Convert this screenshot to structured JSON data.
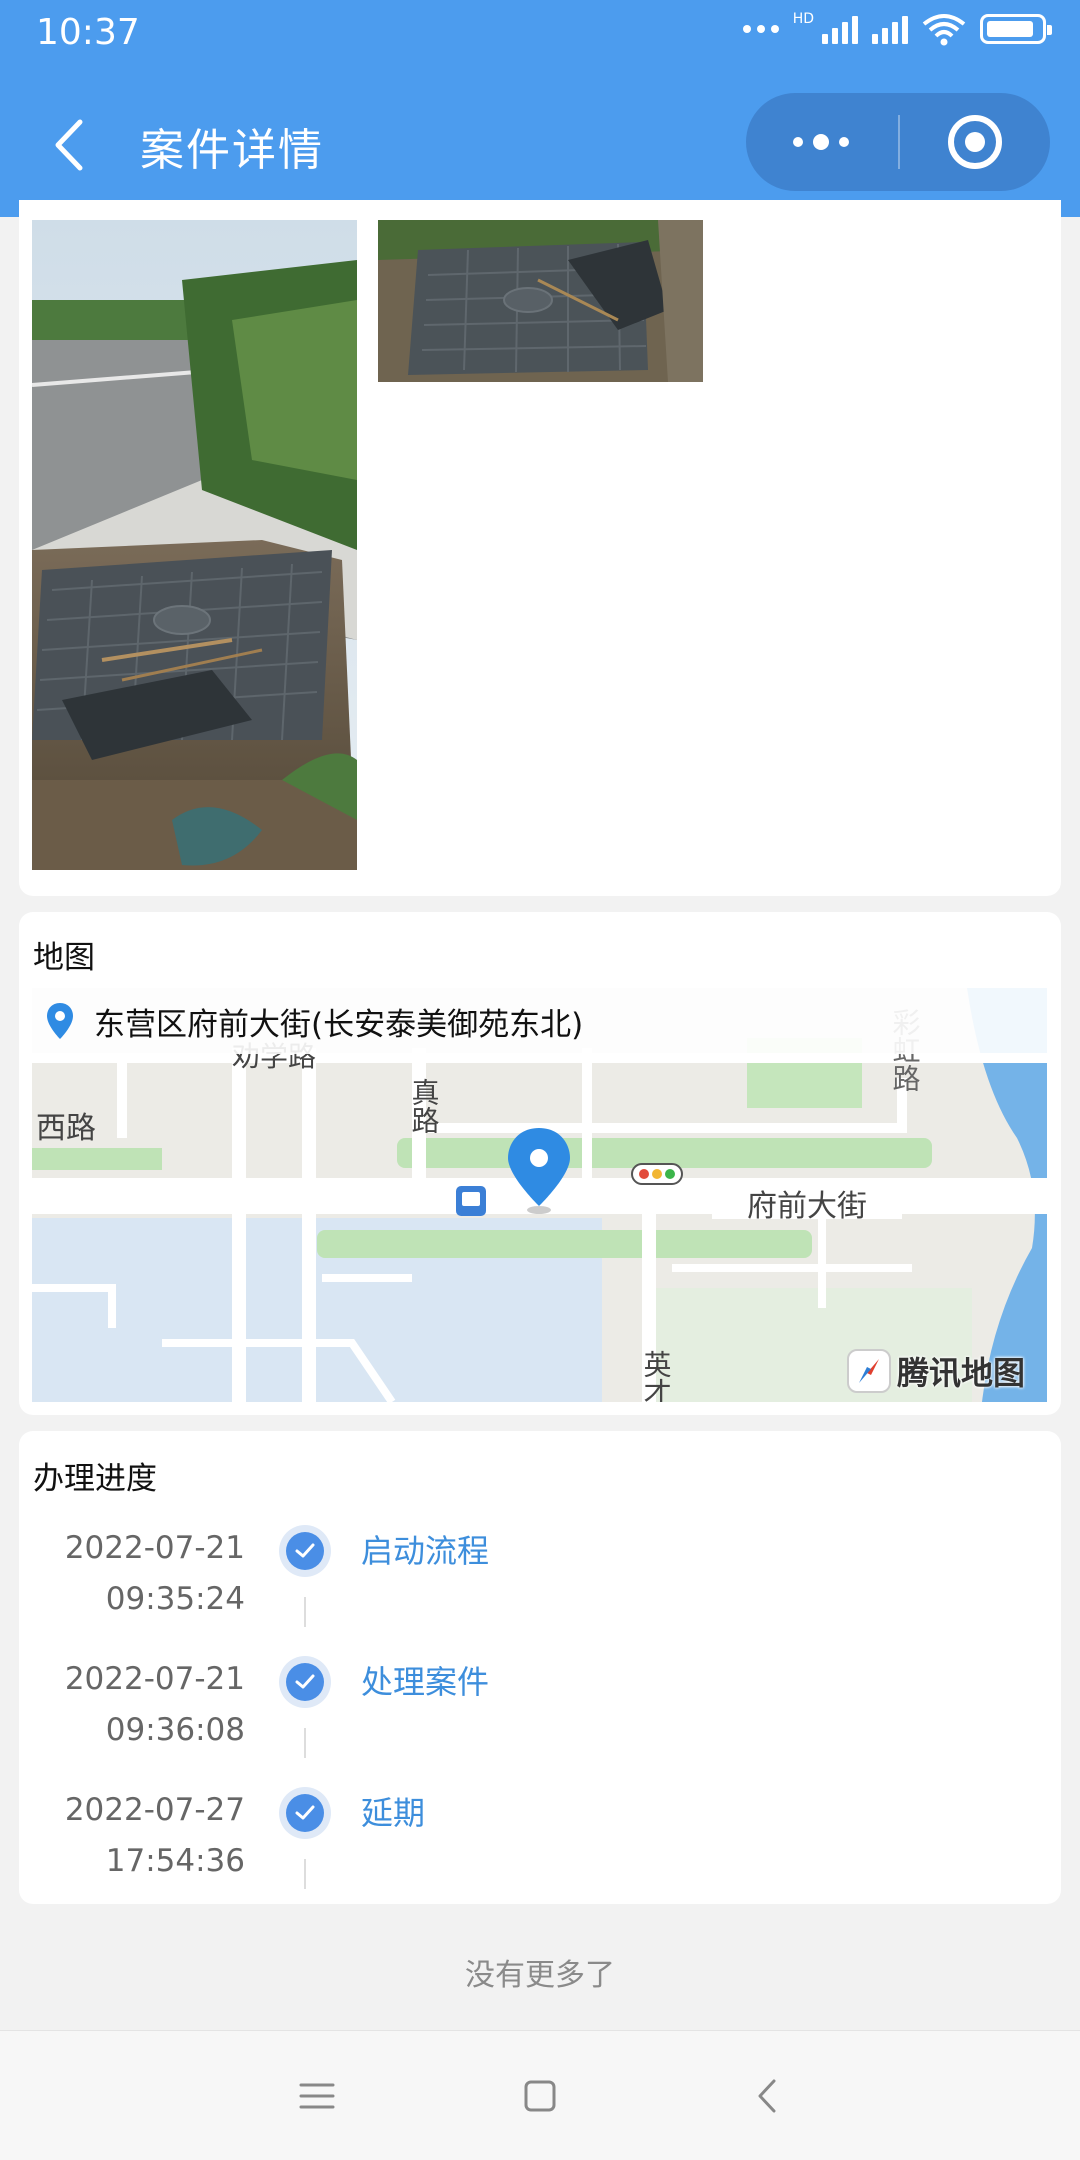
{
  "status": {
    "time": "10:37",
    "hd": "HD"
  },
  "header": {
    "title": "案件详情"
  },
  "map": {
    "title": "地图",
    "address": "东营区府前大街(长安泰美御苑东北)",
    "labels": [
      "府前大街",
      "西路",
      "劝学路",
      "真路",
      "彩虹路",
      "英才"
    ],
    "provider": "腾讯地图"
  },
  "progress": {
    "title": "办理进度",
    "steps": [
      {
        "date": "2022-07-21",
        "time": "09:35:24",
        "label": "启动流程"
      },
      {
        "date": "2022-07-21",
        "time": "09:36:08",
        "label": "处理案件"
      },
      {
        "date": "2022-07-27",
        "time": "17:54:36",
        "label": "延期"
      }
    ]
  },
  "footer": {
    "no_more": "没有更多了"
  },
  "icons": {
    "back": "back-arrow-icon",
    "more": "more-dots-icon",
    "close": "close-ring-icon",
    "pin": "location-pin-icon",
    "check": "check-icon"
  },
  "colors": {
    "header": "#4c9cee",
    "accent": "#3d8edc"
  }
}
